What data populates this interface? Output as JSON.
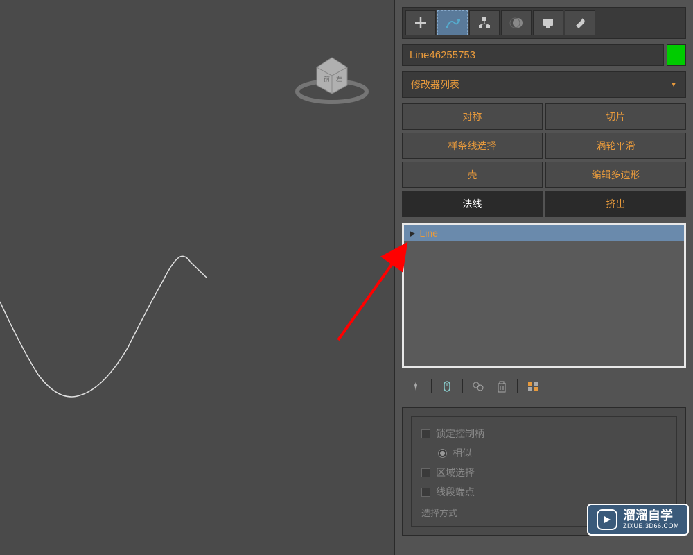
{
  "object_name": "Line46255753",
  "object_color": "#00cc00",
  "modifier_dropdown": {
    "label": "修改器列表"
  },
  "modifier_buttons": [
    {
      "label": "对称"
    },
    {
      "label": "切片"
    },
    {
      "label": "样条线选择"
    },
    {
      "label": "涡轮平滑"
    },
    {
      "label": "壳"
    },
    {
      "label": "编辑多边形"
    },
    {
      "label": "法线"
    },
    {
      "label": "挤出"
    }
  ],
  "stack": {
    "item_label": "Line"
  },
  "params": {
    "lock_handles": "锁定控制柄",
    "similar": "相似",
    "region_select": "区域选择",
    "segment_end": "线段端点",
    "select_method": "选择方式"
  },
  "tabs": {
    "create": "create-tab",
    "modify": "modify-tab",
    "hierarchy": "hierarchy-tab",
    "motion": "motion-tab",
    "display": "display-tab",
    "utilities": "utilities-tab"
  },
  "watermark": {
    "title": "溜溜自学",
    "subtitle": "ZIXUE.3D66.COM"
  }
}
